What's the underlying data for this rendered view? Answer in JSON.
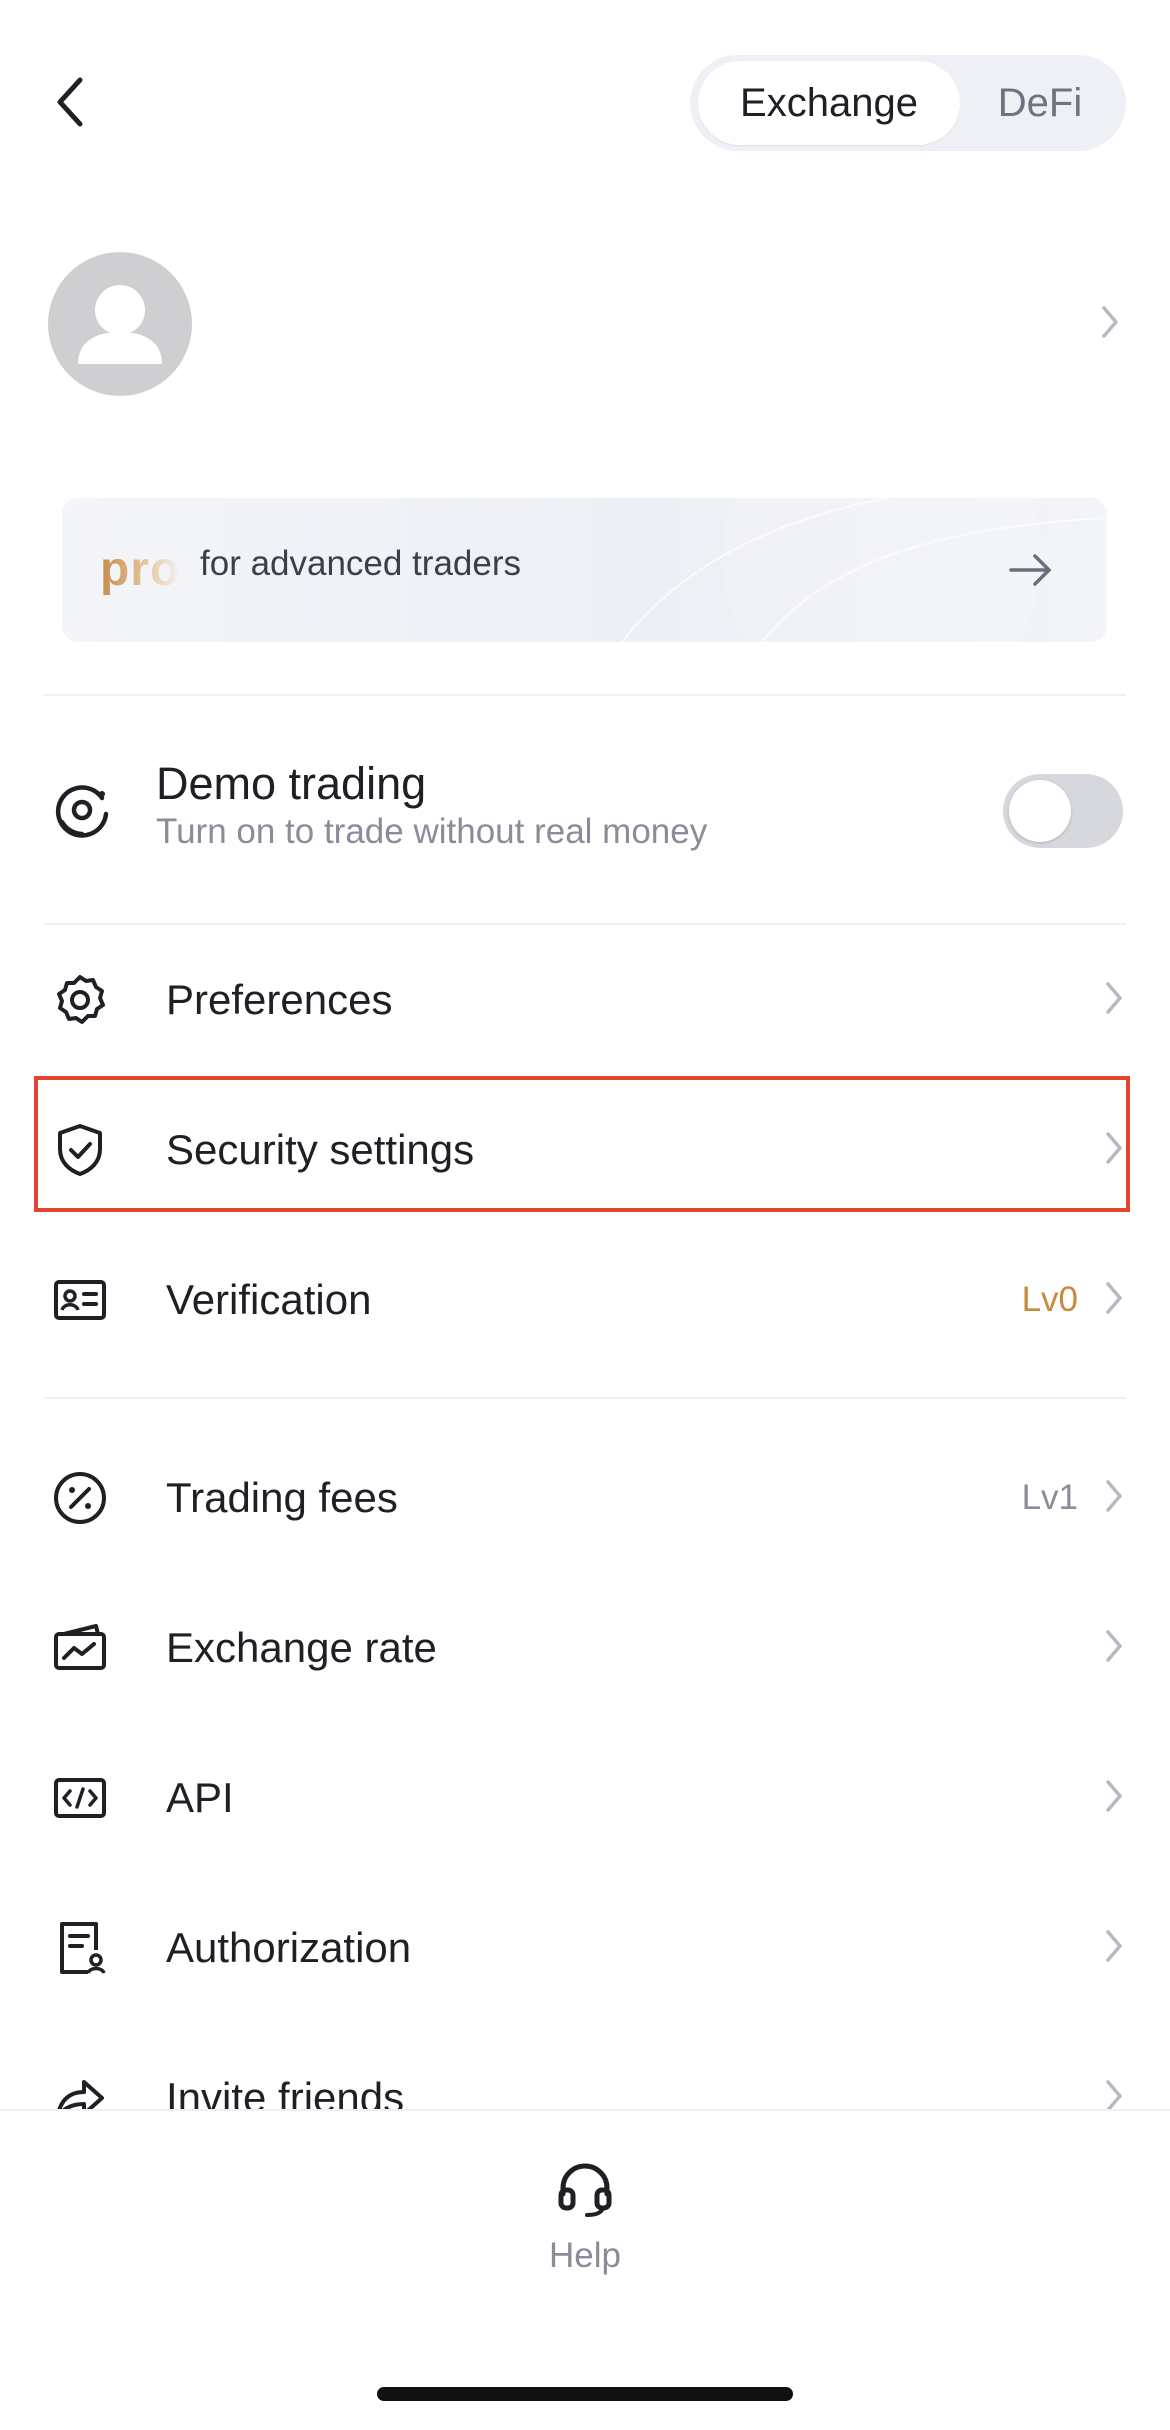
{
  "header": {
    "tabs": [
      {
        "label": "Exchange",
        "active": true
      },
      {
        "label": "DeFi",
        "active": false
      }
    ]
  },
  "pro_banner": {
    "logo_text": "pro",
    "text": "for advanced traders"
  },
  "demo_trading": {
    "title": "Demo trading",
    "subtitle": "Turn on to trade without real money",
    "enabled": false
  },
  "menu": [
    {
      "label": "Preferences",
      "icon": "gear-icon"
    },
    {
      "label": "Security settings",
      "icon": "shield-check-icon",
      "highlighted": true
    },
    {
      "label": "Verification",
      "icon": "id-card-icon",
      "badge": "Lv0"
    },
    {
      "label": "Trading fees",
      "icon": "percent-icon",
      "badge": "Lv1"
    },
    {
      "label": "Exchange rate",
      "icon": "chart-card-icon"
    },
    {
      "label": "API",
      "icon": "code-icon"
    },
    {
      "label": "Authorization",
      "icon": "document-user-icon"
    },
    {
      "label": "Invite friends",
      "icon": "share-icon"
    }
  ],
  "bottom": {
    "help_label": "Help"
  },
  "colors": {
    "highlight": "#e2452f",
    "badge_orange": "#c98a3a",
    "muted": "#8a8d99"
  }
}
